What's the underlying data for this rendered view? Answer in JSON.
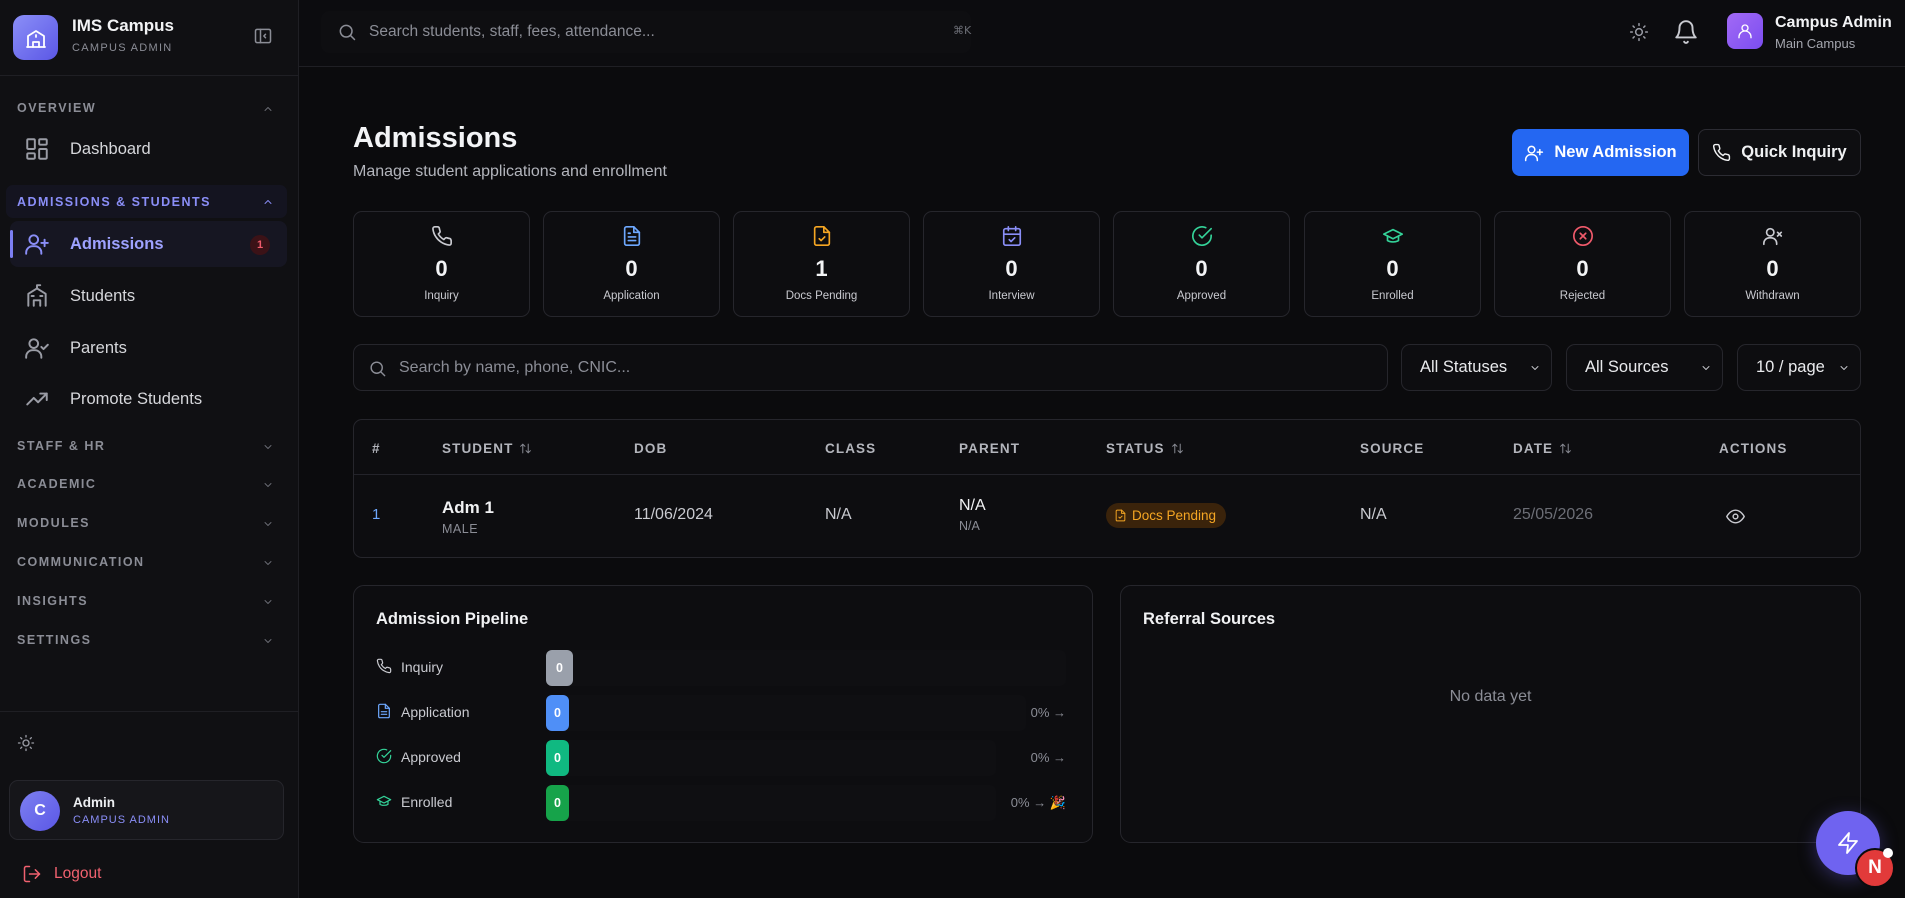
{
  "sidebar": {
    "brand_name": "IMS Campus",
    "brand_sub": "CAMPUS ADMIN",
    "sections": {
      "overview": "OVERVIEW",
      "admissions_students": "ADMISSIONS & STUDENTS",
      "staff_hr": "STAFF & HR",
      "academic": "ACADEMIC",
      "modules": "MODULES",
      "communication": "COMMUNICATION",
      "insights": "INSIGHTS",
      "settings": "SETTINGS"
    },
    "items": {
      "dashboard": "Dashboard",
      "admissions": "Admissions",
      "admissions_badge": "1",
      "students": "Students",
      "parents": "Parents",
      "promote": "Promote Students"
    },
    "user": {
      "initial": "C",
      "name": "Admin",
      "role": "CAMPUS ADMIN"
    },
    "logout": "Logout"
  },
  "topbar": {
    "search_placeholder": "Search students, staff, fees, attendance...",
    "shortcut": "⌘K",
    "user_name": "Campus Admin",
    "user_sub": "Main Campus"
  },
  "page": {
    "title": "Admissions",
    "subtitle": "Manage student applications and enrollment",
    "new_admission": "New Admission",
    "quick_inquiry": "Quick Inquiry"
  },
  "stats": [
    {
      "label": "Inquiry",
      "value": "0",
      "icon": "phone-icon",
      "color": "#c9cad0"
    },
    {
      "label": "Application",
      "value": "0",
      "icon": "file-text-icon",
      "color": "#6ea8fe"
    },
    {
      "label": "Docs Pending",
      "value": "1",
      "icon": "file-check-icon",
      "color": "#f5a623"
    },
    {
      "label": "Interview",
      "value": "0",
      "icon": "calendar-check-icon",
      "color": "#8a8ef7"
    },
    {
      "label": "Approved",
      "value": "0",
      "icon": "check-circle-icon",
      "color": "#34d399"
    },
    {
      "label": "Enrolled",
      "value": "0",
      "icon": "graduation-cap-icon",
      "color": "#34d399"
    },
    {
      "label": "Rejected",
      "value": "0",
      "icon": "x-circle-icon",
      "color": "#f05a6b"
    },
    {
      "label": "Withdrawn",
      "value": "0",
      "icon": "user-x-icon",
      "color": "#c9cad0"
    }
  ],
  "filters": {
    "search_placeholder": "Search by name, phone, CNIC...",
    "status": "All Statuses",
    "source": "All Sources",
    "page_size": "10 / page"
  },
  "table": {
    "columns": [
      "#",
      "STUDENT",
      "DOB",
      "CLASS",
      "PARENT",
      "STATUS",
      "SOURCE",
      "DATE",
      "ACTIONS"
    ],
    "rows": [
      {
        "num": "1",
        "student": "Adm 1",
        "gender": "MALE",
        "dob": "11/06/2024",
        "class": "N/A",
        "parent": "N/A",
        "parent_sub": "N/A",
        "status": "Docs Pending",
        "source": "N/A",
        "date": "25/05/2026"
      }
    ]
  },
  "pipeline": {
    "title": "Admission Pipeline",
    "rows": [
      {
        "label": "Inquiry",
        "value": "0",
        "pct": "",
        "color": "#9aa0ab"
      },
      {
        "label": "Application",
        "value": "0",
        "pct": "0% →",
        "color": "#4f8ff7"
      },
      {
        "label": "Approved",
        "value": "0",
        "pct": "0% →",
        "color": "#10b981"
      },
      {
        "label": "Enrolled",
        "value": "0",
        "pct": "0% → 🎉",
        "color": "#16a34a"
      }
    ]
  },
  "referral": {
    "title": "Referral Sources",
    "empty": "No data yet"
  },
  "fab": {
    "badge": "N"
  }
}
